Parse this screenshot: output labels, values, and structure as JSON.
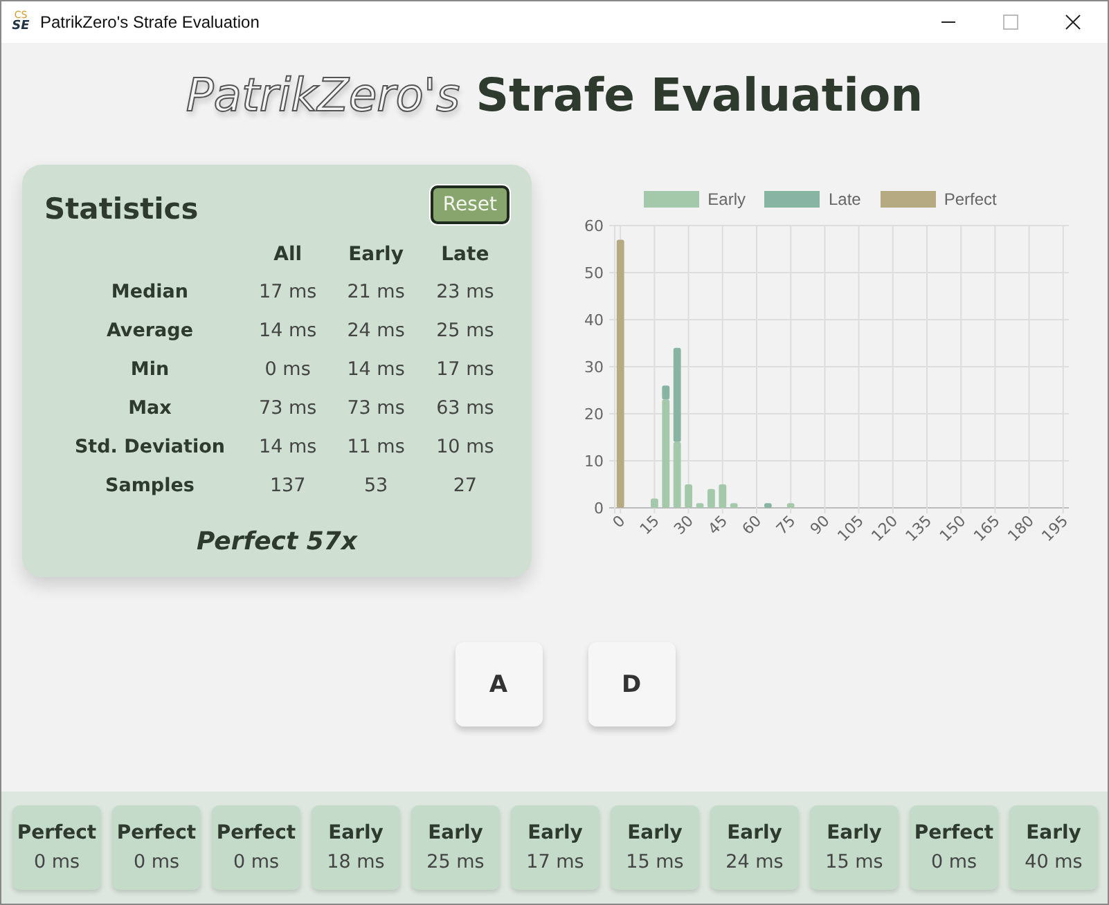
{
  "window": {
    "title": "PatrikZero's Strafe Evaluation",
    "app_icon_top": "CS",
    "app_icon_bottom": "SE"
  },
  "heading": {
    "outlined": "PatrikZero's",
    "main": "Strafe Evaluation"
  },
  "statistics": {
    "title": "Statistics",
    "reset_button": "Reset",
    "columns": [
      "All",
      "Early",
      "Late"
    ],
    "rows": [
      {
        "label": "Median",
        "values": [
          "17 ms",
          "21 ms",
          "23 ms"
        ]
      },
      {
        "label": "Average",
        "values": [
          "14 ms",
          "24 ms",
          "25 ms"
        ]
      },
      {
        "label": "Min",
        "values": [
          "0 ms",
          "14 ms",
          "17 ms"
        ]
      },
      {
        "label": "Max",
        "values": [
          "73 ms",
          "73 ms",
          "63 ms"
        ]
      },
      {
        "label": "Std. Deviation",
        "values": [
          "14 ms",
          "11 ms",
          "10 ms"
        ]
      },
      {
        "label": "Samples",
        "values": [
          "137",
          "53",
          "27"
        ]
      }
    ],
    "summary": "Perfect 57x"
  },
  "histogram": {
    "chart_data": {
      "type": "bar",
      "stacked": true,
      "x": [
        0,
        5,
        10,
        15,
        20,
        25,
        30,
        35,
        40,
        45,
        50,
        55,
        60,
        65,
        70,
        75,
        80,
        85,
        90,
        95,
        100,
        105,
        110,
        115,
        120,
        125,
        130,
        135,
        140,
        145,
        150,
        155,
        160,
        165,
        170,
        175,
        180,
        185,
        190,
        195
      ],
      "xticks": [
        0,
        15,
        30,
        45,
        60,
        75,
        90,
        105,
        120,
        135,
        150,
        165,
        180,
        195
      ],
      "xlim": [
        -2.5,
        197.5
      ],
      "grid": true,
      "legend": "top",
      "yticks": [
        0,
        10,
        20,
        30,
        40,
        50,
        60
      ],
      "ylim": [
        0,
        60
      ],
      "series": [
        {
          "name": "Early",
          "color": "#a3c9aa",
          "values": [
            0,
            0,
            0,
            2,
            23,
            14,
            5,
            1,
            4,
            5,
            1,
            0,
            0,
            0,
            0,
            1,
            0,
            0,
            0,
            0,
            0,
            0,
            0,
            0,
            0,
            0,
            0,
            0,
            0,
            0,
            0,
            0,
            0,
            0,
            0,
            0,
            0,
            0,
            0,
            0
          ]
        },
        {
          "name": "Late",
          "color": "#87b4a3",
          "values": [
            0,
            0,
            0,
            0,
            3,
            20,
            0,
            0,
            0,
            0,
            0,
            0,
            0,
            1,
            0,
            0,
            0,
            0,
            0,
            0,
            0,
            0,
            0,
            0,
            0,
            0,
            0,
            0,
            0,
            0,
            0,
            0,
            0,
            0,
            0,
            0,
            0,
            0,
            0,
            0
          ]
        },
        {
          "name": "Perfect",
          "color": "#b5aa82",
          "values": [
            57,
            0,
            0,
            0,
            0,
            0,
            0,
            0,
            0,
            0,
            0,
            0,
            0,
            0,
            0,
            0,
            0,
            0,
            0,
            0,
            0,
            0,
            0,
            0,
            0,
            0,
            0,
            0,
            0,
            0,
            0,
            0,
            0,
            0,
            0,
            0,
            0,
            0,
            0,
            0
          ]
        }
      ]
    }
  },
  "keys": [
    "A",
    "D"
  ],
  "history": [
    {
      "kind": "Perfect",
      "value": "0 ms"
    },
    {
      "kind": "Perfect",
      "value": "0 ms"
    },
    {
      "kind": "Perfect",
      "value": "0 ms"
    },
    {
      "kind": "Early",
      "value": "18 ms"
    },
    {
      "kind": "Early",
      "value": "25 ms"
    },
    {
      "kind": "Early",
      "value": "17 ms"
    },
    {
      "kind": "Early",
      "value": "15 ms"
    },
    {
      "kind": "Early",
      "value": "24 ms"
    },
    {
      "kind": "Early",
      "value": "15 ms"
    },
    {
      "kind": "Perfect",
      "value": "0 ms"
    },
    {
      "kind": "Early",
      "value": "40 ms"
    }
  ]
}
